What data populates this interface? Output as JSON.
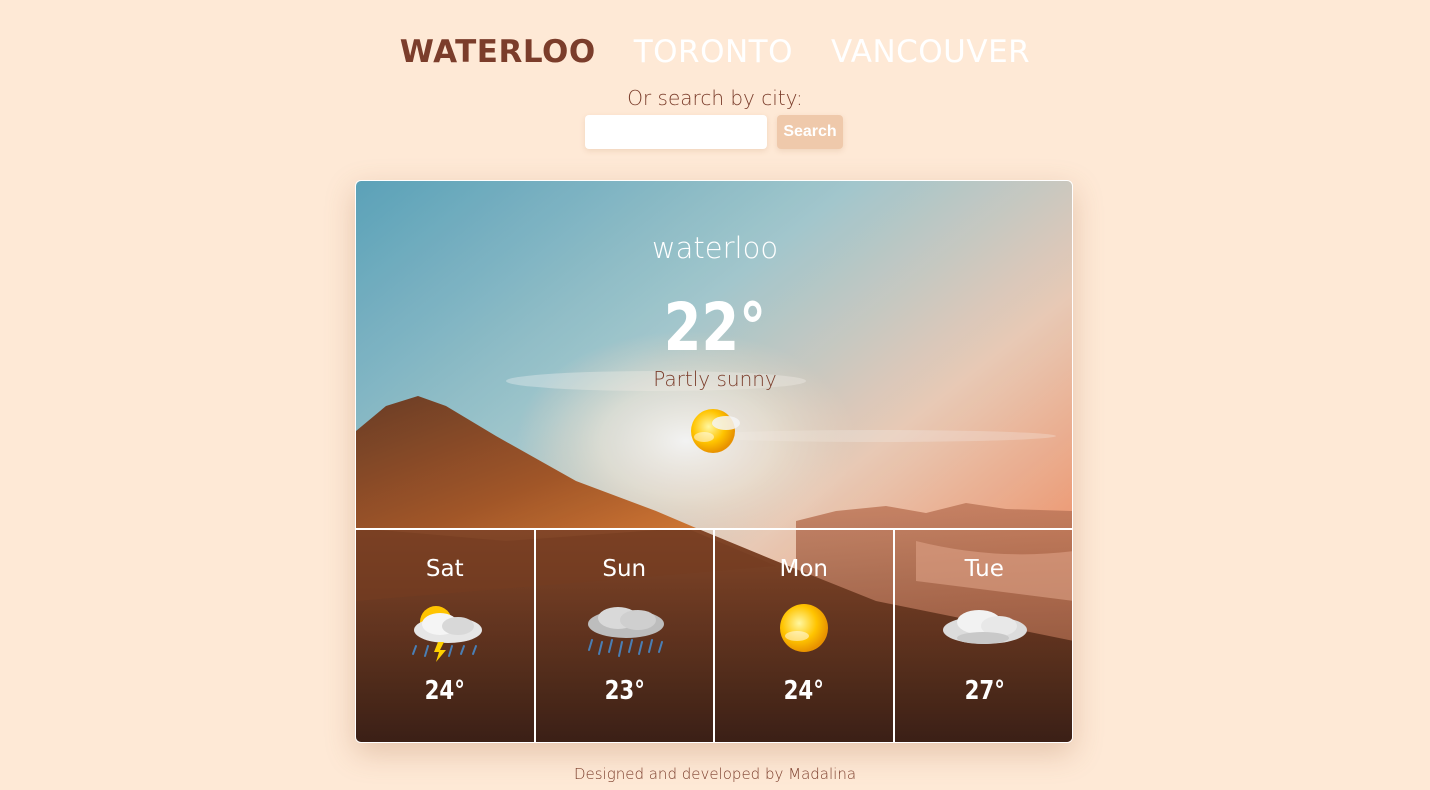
{
  "nav": {
    "cities": [
      {
        "label": "WATERLOO",
        "active": true
      },
      {
        "label": "TORONTO",
        "active": false
      },
      {
        "label": "VANCOUVER",
        "active": false
      }
    ]
  },
  "search": {
    "label": "Or search by city:",
    "value": "",
    "placeholder": "",
    "button_label": "Search"
  },
  "current": {
    "city": "waterloo",
    "temperature": "22°",
    "condition": "Partly sunny",
    "icon": "partly-sunny-icon"
  },
  "forecast": [
    {
      "day": "Sat",
      "temp": "24°",
      "icon": "thunderstorm-icon"
    },
    {
      "day": "Sun",
      "temp": "23°",
      "icon": "rain-icon"
    },
    {
      "day": "Mon",
      "temp": "24°",
      "icon": "sun-icon"
    },
    {
      "day": "Tue",
      "temp": "27°",
      "icon": "cloudy-icon"
    }
  ],
  "footer": {
    "text": "Designed and developed by Madalina"
  },
  "colors": {
    "page_background": "#fee9d6",
    "accent_text": "#7b3d2b",
    "button": "#efc9ab"
  }
}
